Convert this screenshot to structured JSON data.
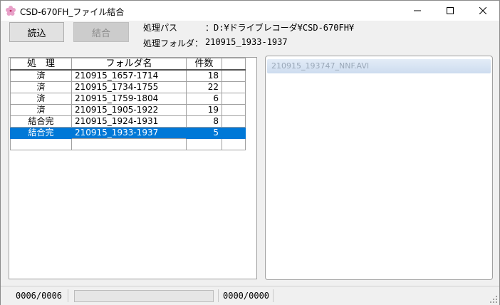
{
  "window": {
    "title": "CSD-670FH_ファイル結合"
  },
  "toolbar": {
    "load_label": "読込",
    "merge_label": "結合"
  },
  "info": {
    "path_label": "処理パス",
    "path_value": "：D:¥ドライブレコーダ¥CSD-670FH¥",
    "folder_label": "処理フォルダ：",
    "folder_value": "210915_1933-1937"
  },
  "grid": {
    "headers": [
      "処　理",
      "フォルダ名",
      "件数",
      ""
    ],
    "rows": [
      {
        "status": "済",
        "folder": "210915_1657-1714",
        "count": "18"
      },
      {
        "status": "済",
        "folder": "210915_1734-1755",
        "count": "22"
      },
      {
        "status": "済",
        "folder": "210915_1759-1804",
        "count": "6"
      },
      {
        "status": "済",
        "folder": "210915_1905-1922",
        "count": "19"
      },
      {
        "status": "結合完",
        "folder": "210915_1924-1931",
        "count": "8"
      },
      {
        "status": "結合完",
        "folder": "210915_1933-1937",
        "count": "5"
      }
    ]
  },
  "files": {
    "header": "210915_193747_NNF.AVI"
  },
  "status": {
    "count_text": "0006/0006",
    "bytes_text": "0000/0000",
    "progress": 0
  },
  "icons": {
    "app": "sakura-icon",
    "minimize": "minimize-icon",
    "maximize": "maximize-icon",
    "close": "close-icon"
  }
}
